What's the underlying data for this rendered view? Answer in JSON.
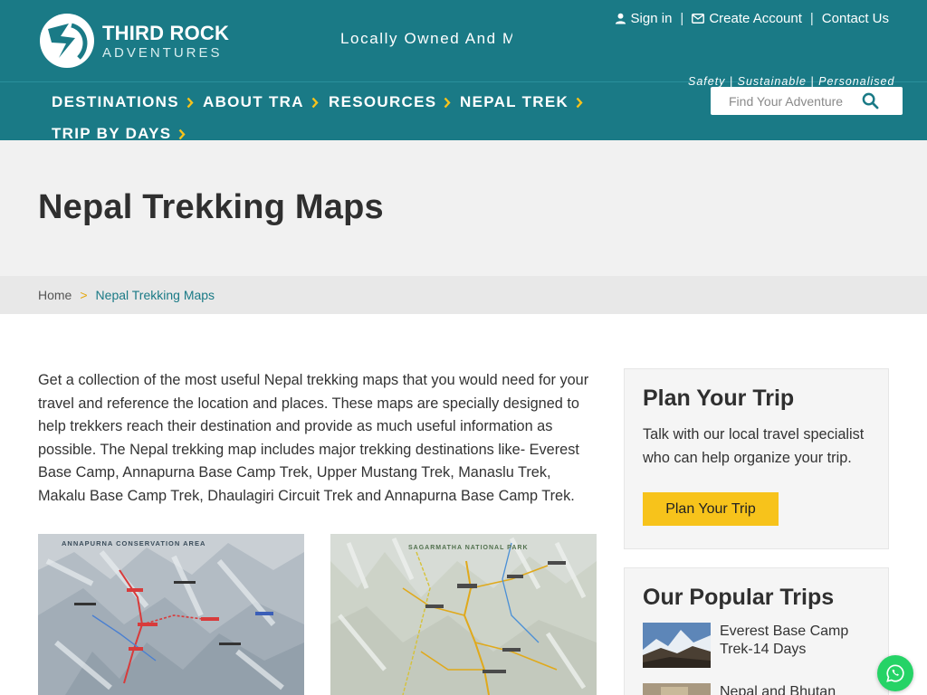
{
  "header": {
    "logo_title": "THIRD ROCK",
    "logo_subtitle": "ADVENTURES",
    "tagline": "Locally Owned And Managed",
    "slogan": "Safety | Sustainable | Personalised",
    "sign_in": "Sign in",
    "create_account": "Create Account",
    "contact_us": "Contact Us",
    "separator": "|",
    "search_placeholder": "Find Your Adventure",
    "brand_color": "#1a7a86",
    "accent_color": "#f7c31b"
  },
  "nav": {
    "items": [
      {
        "label": "DESTINATIONS"
      },
      {
        "label": "ABOUT TRA"
      },
      {
        "label": "RESOURCES"
      },
      {
        "label": "NEPAL TREK"
      },
      {
        "label": "TRIP BY DAYS"
      }
    ]
  },
  "page": {
    "title": "Nepal Trekking Maps"
  },
  "breadcrumb": {
    "home": "Home",
    "separator": ">",
    "current": "Nepal Trekking Maps"
  },
  "main": {
    "intro": "Get a collection of the most useful Nepal trekking maps that you would need for your travel and reference the location and places. These maps are specially designed to help trekkers reach their destination and provide as much useful information as possible. The Nepal trekking map includes major trekking destinations like- Everest Base Camp, Annapurna Base Camp Trek, Upper Mustang Trek, Manaslu Trek, Makalu Base Camp Trek, Dhaulagiri Circuit Trek and Annapurna Base Camp Trek.",
    "maps": [
      {
        "caption": "ANNAPURNA CONSERVATION AREA"
      },
      {
        "caption": "SAGARMATHA NATIONAL PARK"
      }
    ]
  },
  "sidebar": {
    "plan": {
      "title": "Plan Your Trip",
      "text": "Talk with our local travel specialist who can help organize your trip.",
      "button": "Plan Your Trip"
    },
    "popular": {
      "title": "Our Popular Trips",
      "trips": [
        {
          "name": "Everest Base Camp Trek-14 Days"
        },
        {
          "name": "Nepal and Bhutan"
        }
      ]
    }
  },
  "icons": {
    "user": "user-icon",
    "mail": "envelope-icon",
    "search": "search-icon",
    "chevron": "chevron-right-icon",
    "whatsapp": "whatsapp-icon"
  }
}
